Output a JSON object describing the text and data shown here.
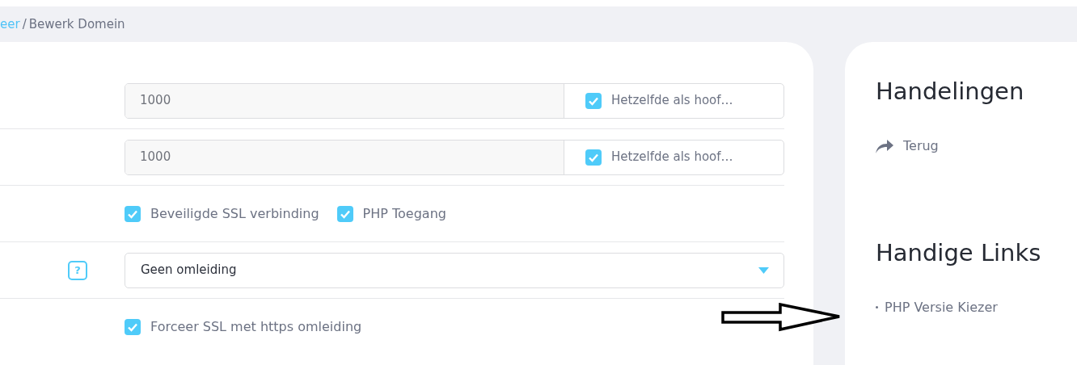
{
  "breadcrumb": {
    "link": "eer",
    "separator": "/",
    "current": "Bewerk Domein"
  },
  "form_rows": [
    {
      "kind": "input_check",
      "value": "1000",
      "check": {
        "label": "Hetzelfde als hoof…",
        "checked": true
      }
    },
    {
      "kind": "input_check",
      "value": "1000",
      "check": {
        "label": "Hetzelfde als hoof…",
        "checked": true
      }
    },
    {
      "kind": "checks",
      "checks": [
        {
          "label": "Beveiligde SSL verbinding",
          "checked": true
        },
        {
          "label": "PHP Toegang",
          "checked": true
        }
      ]
    },
    {
      "kind": "select",
      "help": "?",
      "value": "Geen omleiding"
    },
    {
      "kind": "checks",
      "checks": [
        {
          "label": "Forceer SSL met https omleiding",
          "checked": true
        }
      ]
    }
  ],
  "sidebar": [
    {
      "title": "Handelingen",
      "items": [
        {
          "kind": "action",
          "label": "Terug"
        }
      ]
    },
    {
      "title": "Handige Links",
      "items": [
        {
          "kind": "bullet",
          "label": "PHP Versie Kiezer"
        }
      ]
    }
  ]
}
